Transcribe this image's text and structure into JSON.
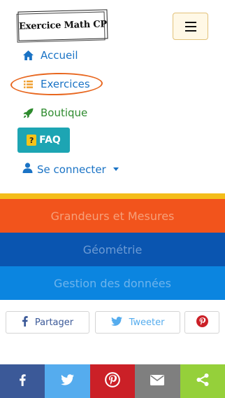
{
  "header": {
    "logo_text": "Exercice Math CP"
  },
  "nav": {
    "home_label": "Accueil",
    "exercices_label": "Exercices",
    "boutique_label": "Boutique",
    "faq_label": "FAQ",
    "faq_icon_text": "?",
    "login_label": "Se connecter"
  },
  "bands": [
    {
      "label": "Grandeurs et Mesures"
    },
    {
      "label": "Géométrie"
    },
    {
      "label": "Gestion des données"
    }
  ],
  "share": {
    "facebook_label": "Partager",
    "twitter_label": "Tweeter"
  },
  "icons": {
    "home": "home-icon",
    "list": "list-icon",
    "rocket": "rocket-icon",
    "user": "user-icon",
    "facebook": "facebook-icon",
    "twitter": "twitter-icon",
    "pinterest": "pinterest-icon",
    "mail": "mail-icon",
    "share": "share-icon"
  },
  "colors": {
    "accent_blue": "#1a73c5",
    "green": "#2e8b2e",
    "faq_teal": "#1da5b3",
    "band_orange": "#f2541c",
    "band_dark_blue": "#0a55b0",
    "band_blue": "#0b85e0",
    "highlight_orange": "#e8671f"
  }
}
